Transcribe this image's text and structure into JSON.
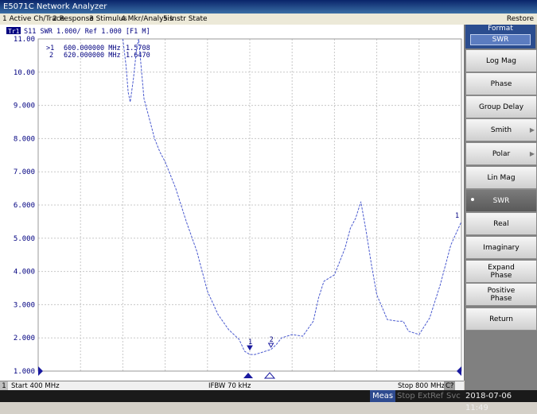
{
  "window": {
    "title": "E5071C Network Analyzer",
    "restore_label": "Restore"
  },
  "menu": {
    "items": [
      "1 Active Ch/Trace",
      "2 Response",
      "3 Stimulus",
      "4 Mkr/Analysis",
      "5 Instr State"
    ]
  },
  "trace_header": {
    "badge": "Tr1",
    "text": "S11  SWR 1.000/ Ref 1.000  [F1 M]"
  },
  "markers": [
    {
      "id": ">1",
      "freq": "600.000000 MHz",
      "value": "1.5708"
    },
    {
      "id": "2",
      "freq": "620.000000 MHz",
      "value": "1.6470"
    }
  ],
  "chart_data": {
    "type": "line",
    "ylabels": [
      "11.00",
      "10.00",
      "9.000",
      "8.000",
      "7.000",
      "6.000",
      "5.000",
      "4.000",
      "3.000",
      "2.000",
      "1.000"
    ],
    "ylim": [
      1.0,
      11.0
    ],
    "xlim": [
      400,
      800
    ],
    "x_unit": "MHz",
    "grid": true,
    "series": [
      {
        "x": [
          480,
          483,
          485,
          487,
          490,
          493,
          495,
          500,
          505,
          510,
          515,
          520,
          525,
          530,
          540,
          550,
          560,
          570,
          580,
          590,
          595,
          600,
          605,
          610,
          620,
          625,
          630,
          640,
          650,
          660,
          665,
          670,
          680,
          690,
          695,
          700,
          705,
          710,
          715,
          720,
          730,
          740,
          745,
          750,
          760,
          770,
          780,
          790,
          800
        ],
        "values": [
          11.0,
          10.2,
          9.4,
          9.1,
          9.8,
          10.7,
          11.0,
          9.2,
          8.6,
          8.0,
          7.6,
          7.3,
          6.9,
          6.5,
          5.5,
          4.6,
          3.4,
          2.7,
          2.25,
          1.95,
          1.6,
          1.5,
          1.5,
          1.55,
          1.65,
          1.8,
          2.0,
          2.1,
          2.05,
          2.5,
          3.2,
          3.7,
          3.9,
          4.7,
          5.3,
          5.6,
          6.1,
          5.2,
          4.2,
          3.3,
          2.55,
          2.5,
          2.5,
          2.2,
          2.1,
          2.6,
          3.6,
          4.8,
          5.5
        ]
      }
    ],
    "marker_points": [
      {
        "label": "1",
        "x": 600,
        "y": 1.5708
      },
      {
        "label": "2",
        "x": 620,
        "y": 1.647
      }
    ],
    "trace_color": "#4a5acf"
  },
  "status": {
    "channel": "1",
    "start": "Start 400 MHz",
    "ifbw": "IFBW 70 kHz",
    "stop": "Stop 800 MHz",
    "cal_badge": "C?"
  },
  "bottom": {
    "meas": "Meas",
    "stop": "Stop",
    "extref": "ExtRef",
    "svc": "Svc",
    "datetime": "2018-07-06 11:49"
  },
  "softkeys": {
    "header_title": "Format",
    "header_value": "SWR",
    "items": [
      {
        "label": "Log Mag",
        "has_arrow": false,
        "selected": false
      },
      {
        "label": "Phase",
        "has_arrow": false,
        "selected": false
      },
      {
        "label": "Group Delay",
        "has_arrow": false,
        "selected": false
      },
      {
        "label": "Smith",
        "has_arrow": true,
        "selected": false
      },
      {
        "label": "Polar",
        "has_arrow": true,
        "selected": false
      },
      {
        "label": "Lin Mag",
        "has_arrow": false,
        "selected": false
      },
      {
        "label": "SWR",
        "has_arrow": false,
        "selected": true
      },
      {
        "label": "Real",
        "has_arrow": false,
        "selected": false
      },
      {
        "label": "Imaginary",
        "has_arrow": false,
        "selected": false
      },
      {
        "label": "Expand\nPhase",
        "has_arrow": false,
        "selected": false
      },
      {
        "label": "Positive\nPhase",
        "has_arrow": false,
        "selected": false
      },
      {
        "label": "Return",
        "has_arrow": false,
        "selected": false
      }
    ]
  }
}
